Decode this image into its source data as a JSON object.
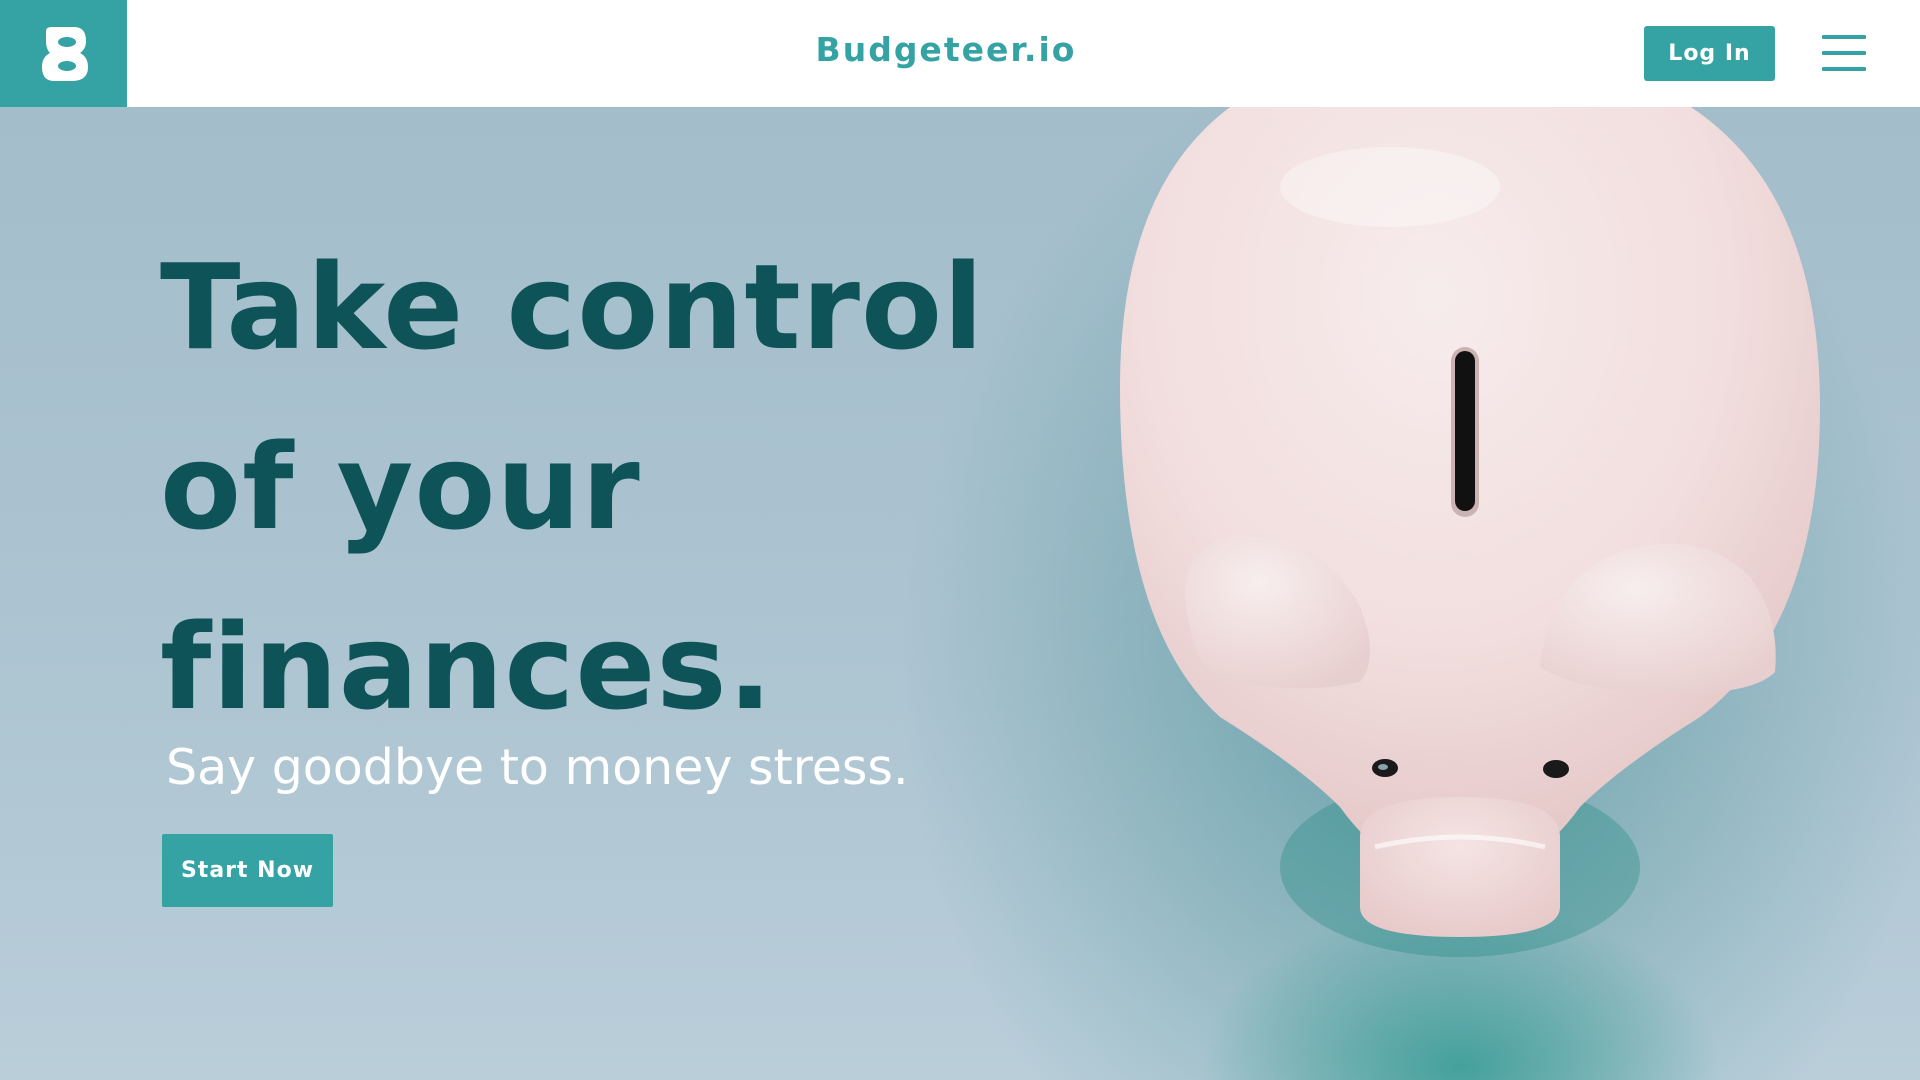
{
  "header": {
    "brand": "Budgeteer.io",
    "login_label": "Log In",
    "logo_icon": "budgeteer-b-logo-icon",
    "menu_icon": "hamburger-menu-icon"
  },
  "hero": {
    "headline_lines": [
      "Take control",
      "of your",
      "finances."
    ],
    "subtitle": "Say goodbye to money stress.",
    "cta_label": "Start Now",
    "image": "piggy-bank-photo"
  },
  "colors": {
    "accent": "#35a3a4",
    "headline": "#0e5357",
    "background": "#a9c2cf",
    "header_bg": "#ffffff"
  }
}
